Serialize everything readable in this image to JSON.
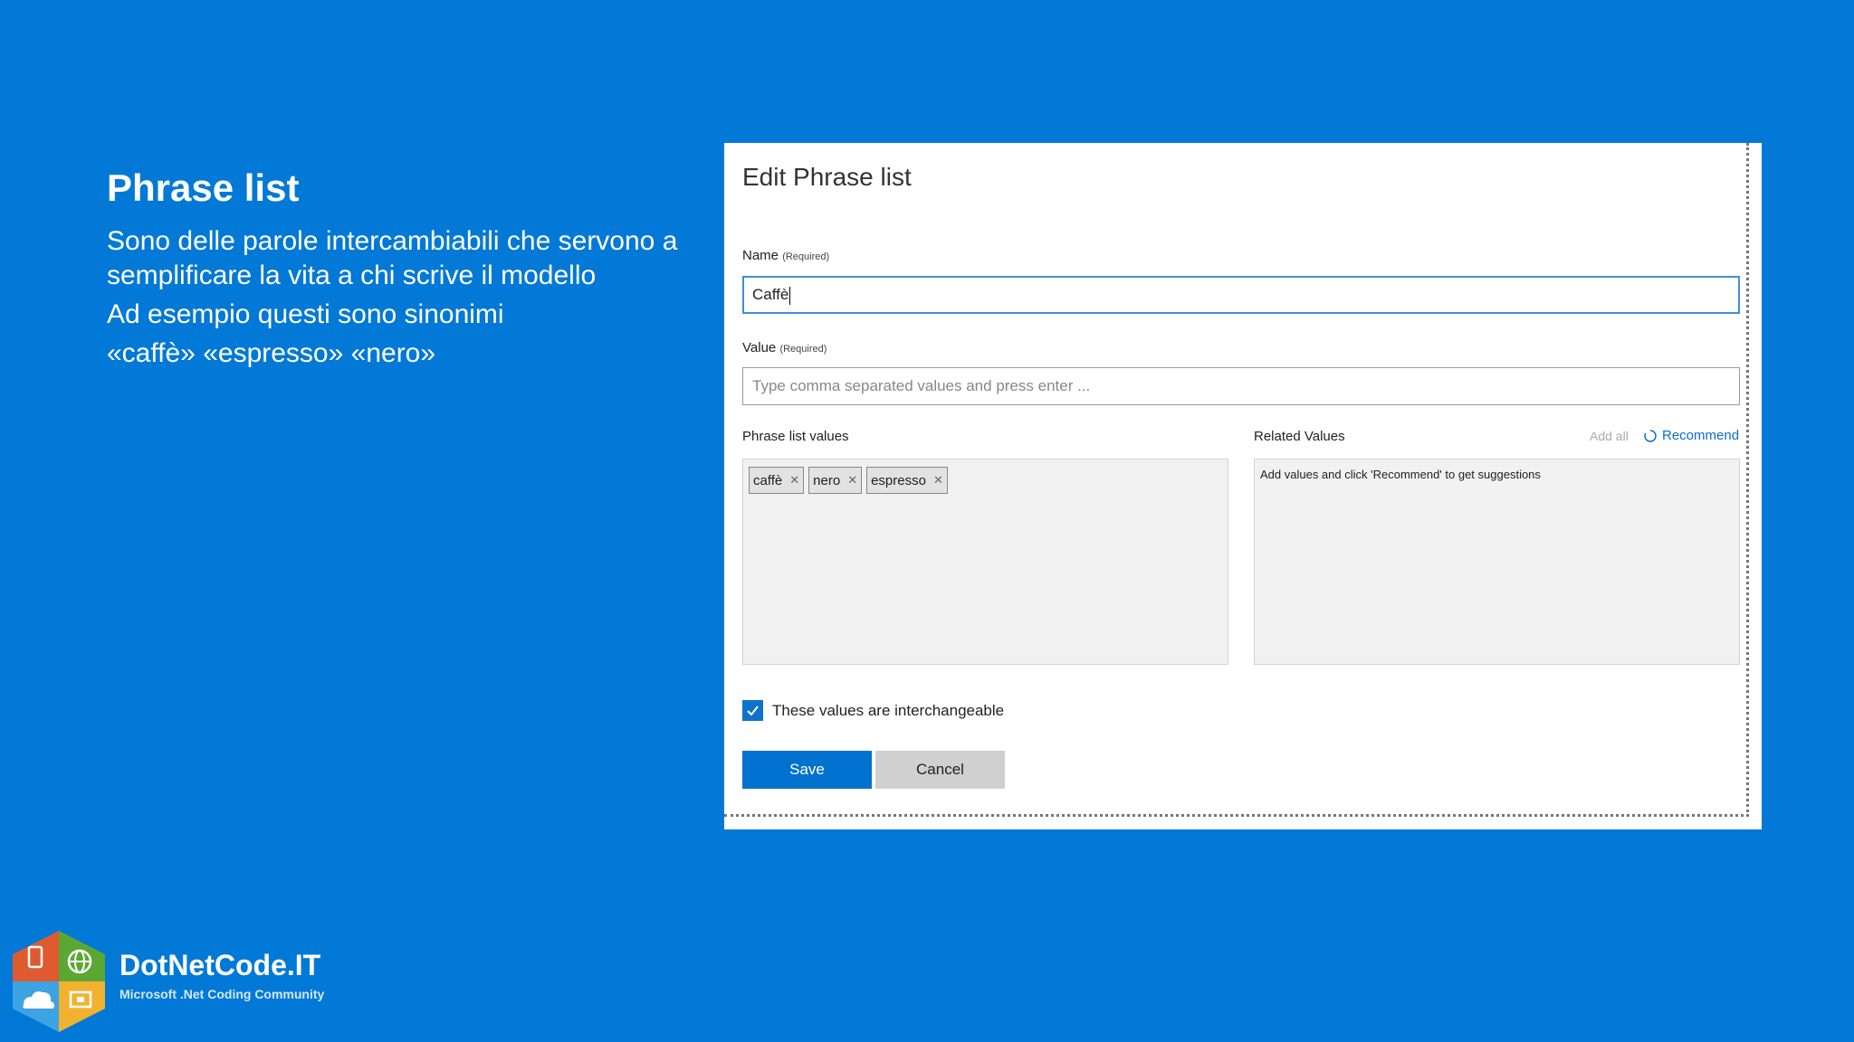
{
  "slide": {
    "title": "Phrase list",
    "lines": [
      "Sono delle parole intercambiabili che servono a semplificare la vita a chi scrive il modello",
      "Ad esempio questi sono sinonimi",
      "«caffè» «espresso» «nero»"
    ]
  },
  "dialog": {
    "title": "Edit Phrase list",
    "name_label": "Name",
    "name_required": "(Required)",
    "name_value": "Caffè",
    "value_label": "Value",
    "value_required": "(Required)",
    "value_placeholder": "Type comma separated values and press enter ...",
    "phrase_values_label": "Phrase list values",
    "phrase_values": [
      "caffè",
      "nero",
      "espresso"
    ],
    "related_label": "Related Values",
    "add_all": "Add all",
    "recommend": "Recommend",
    "related_hint": "Add values and click 'Recommend' to get suggestions",
    "interchangeable_label": "These values are interchangeable",
    "interchangeable_checked": true,
    "save": "Save",
    "cancel": "Cancel"
  },
  "logo": {
    "title": "DotNetCode.IT",
    "subtitle": "Microsoft .Net Coding Community"
  },
  "colors": {
    "background": "#0279d7",
    "accent": "#0071cf",
    "link": "#0a6fc7"
  }
}
